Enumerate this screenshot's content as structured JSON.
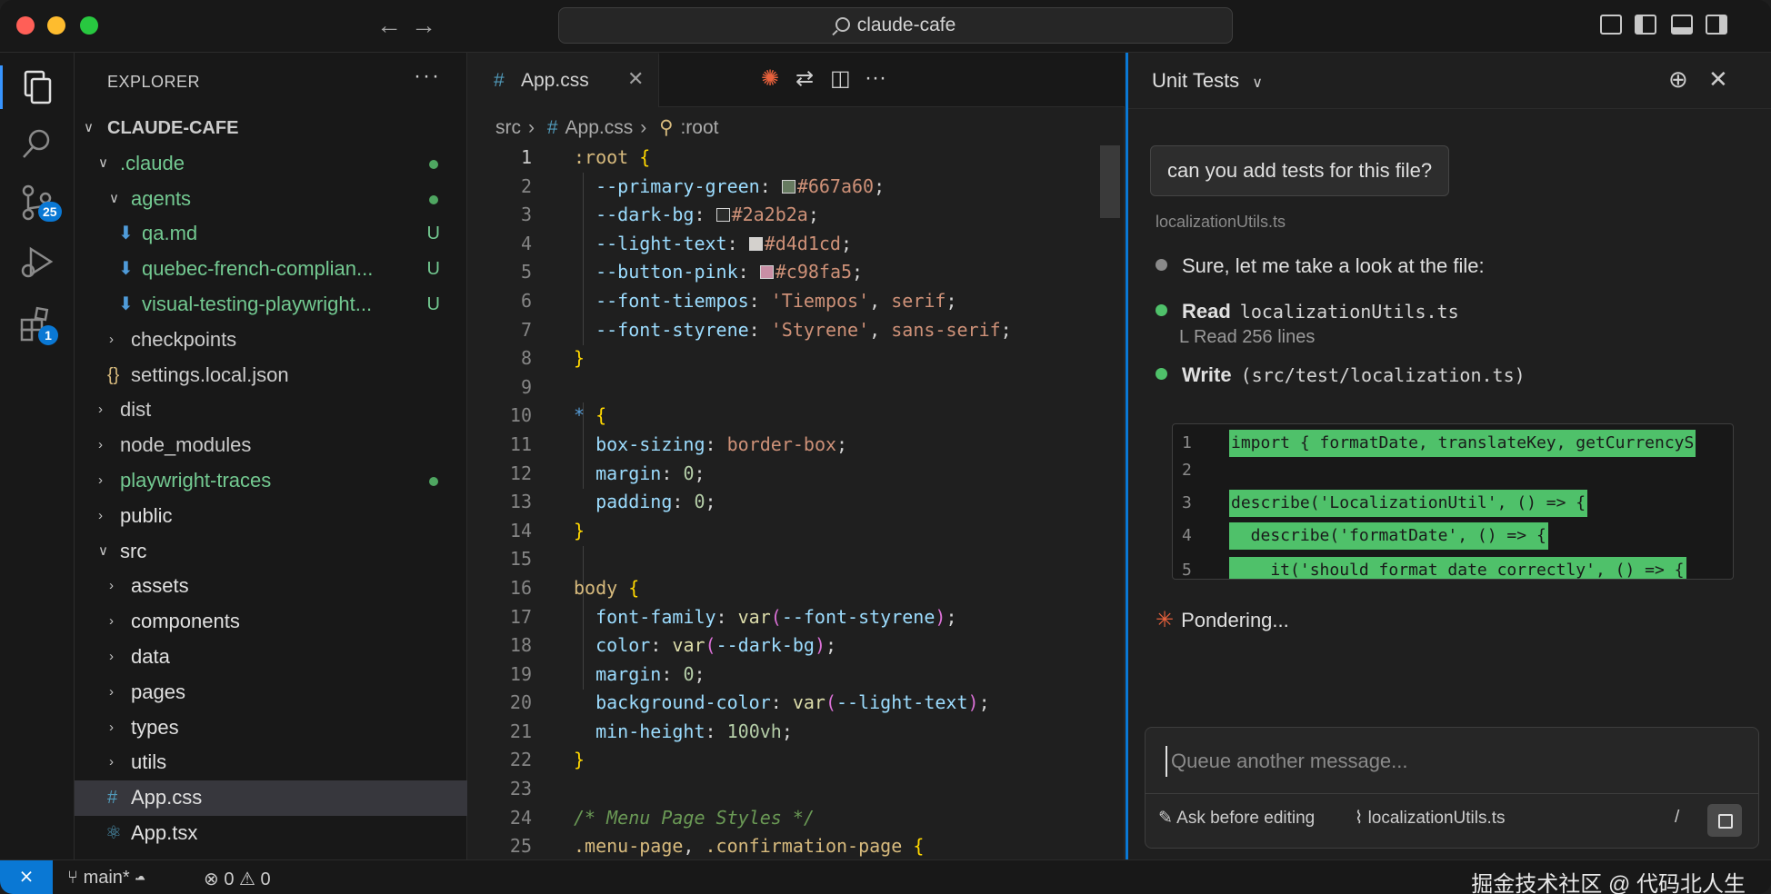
{
  "titlebar": {
    "search_text": "claude-cafe"
  },
  "activity_bar": {
    "source_control_badge": "25",
    "extensions_badge": "1"
  },
  "explorer": {
    "header": "EXPLORER",
    "more": "···",
    "root": "CLAUDE-CAFE",
    "items": [
      {
        "label": ".claude",
        "status": "dot"
      },
      {
        "label": "agents",
        "status": "dot"
      },
      {
        "label": "qa.md",
        "status": "U"
      },
      {
        "label": "quebec-french-complian...",
        "status": "U"
      },
      {
        "label": "visual-testing-playwright...",
        "status": "U"
      },
      {
        "label": "checkpoints",
        "status": ""
      },
      {
        "label": "settings.local.json",
        "status": ""
      },
      {
        "label": "dist",
        "status": ""
      },
      {
        "label": "node_modules",
        "status": ""
      },
      {
        "label": "playwright-traces",
        "status": "dot"
      },
      {
        "label": "public",
        "status": ""
      },
      {
        "label": "src",
        "status": ""
      },
      {
        "label": "assets",
        "status": ""
      },
      {
        "label": "components",
        "status": ""
      },
      {
        "label": "data",
        "status": ""
      },
      {
        "label": "pages",
        "status": ""
      },
      {
        "label": "types",
        "status": ""
      },
      {
        "label": "utils",
        "status": ""
      },
      {
        "label": "App.css",
        "status": ""
      },
      {
        "label": "App.tsx",
        "status": ""
      }
    ]
  },
  "editor": {
    "tab_label": "App.css",
    "breadcrumbs": [
      "src",
      "App.css",
      ":root"
    ],
    "line_numbers": [
      "1",
      "2",
      "3",
      "4",
      "5",
      "6",
      "7",
      "8",
      "9",
      "10",
      "11",
      "12",
      "13",
      "14",
      "15",
      "16",
      "17",
      "18",
      "19",
      "20",
      "21",
      "22",
      "23",
      "24",
      "25"
    ],
    "colors": {
      "primary_green": "#667a60",
      "dark_bg": "#2a2b2a",
      "light_text": "#d4d1cd",
      "button_pink": "#c98fa5"
    }
  },
  "chat": {
    "title": "Unit Tests",
    "user_message": "can you add tests for this file?",
    "context_file": "localizationUtils.ts",
    "step1": "Sure, let me take a look at the file:",
    "step2_action": "Read",
    "step2_file": "localizationUtils.ts",
    "step2_detail": "L  Read 256 lines",
    "step3_action": "Write",
    "step3_file": "(src/test/localization.ts)",
    "preview": [
      {
        "n": "1",
        "code": "import { formatDate, translateKey, getCurrencyS"
      },
      {
        "n": "2",
        "code": ""
      },
      {
        "n": "3",
        "code": "describe('LocalizationUtil', () => {"
      },
      {
        "n": "4",
        "code": "  describe('formatDate', () => {"
      },
      {
        "n": "5",
        "code": "    it('should format date correctly', () => {"
      }
    ],
    "pondering": "Pondering...",
    "input_placeholder": "Queue another message...",
    "ask_before_editing": "Ask before editing",
    "attached_file": "localizationUtils.ts",
    "slash": "/"
  },
  "statusbar": {
    "branch": "main*",
    "errors": "0",
    "warnings": "0",
    "watermark": "掘金技术社区 @ 代码北人生"
  }
}
